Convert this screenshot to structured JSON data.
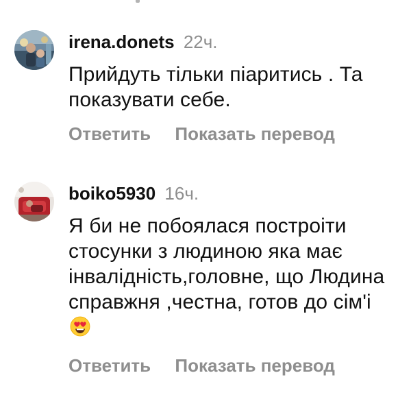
{
  "comments": [
    {
      "username": "irena.donets",
      "time": "22ч.",
      "text": "Прийдуть тільки піаритись . Та показувати себе.",
      "reply_label": "Ответить",
      "translate_label": "Показать перевод",
      "avatar_icon": "profile-photo"
    },
    {
      "username": "boiko5930",
      "time": "16ч.",
      "text": "Я би не побоялася построіти стосунки з людиною яка має інвалідність,головне, що Людина справжня ,честна, готов до сім'і",
      "emoji": "heart-eyes-emoji",
      "reply_label": "Ответить",
      "translate_label": "Показать перевод",
      "avatar_icon": "profile-photo"
    }
  ],
  "colors": {
    "text": "#111111",
    "secondary": "#8e8e8e",
    "background": "#ffffff"
  }
}
